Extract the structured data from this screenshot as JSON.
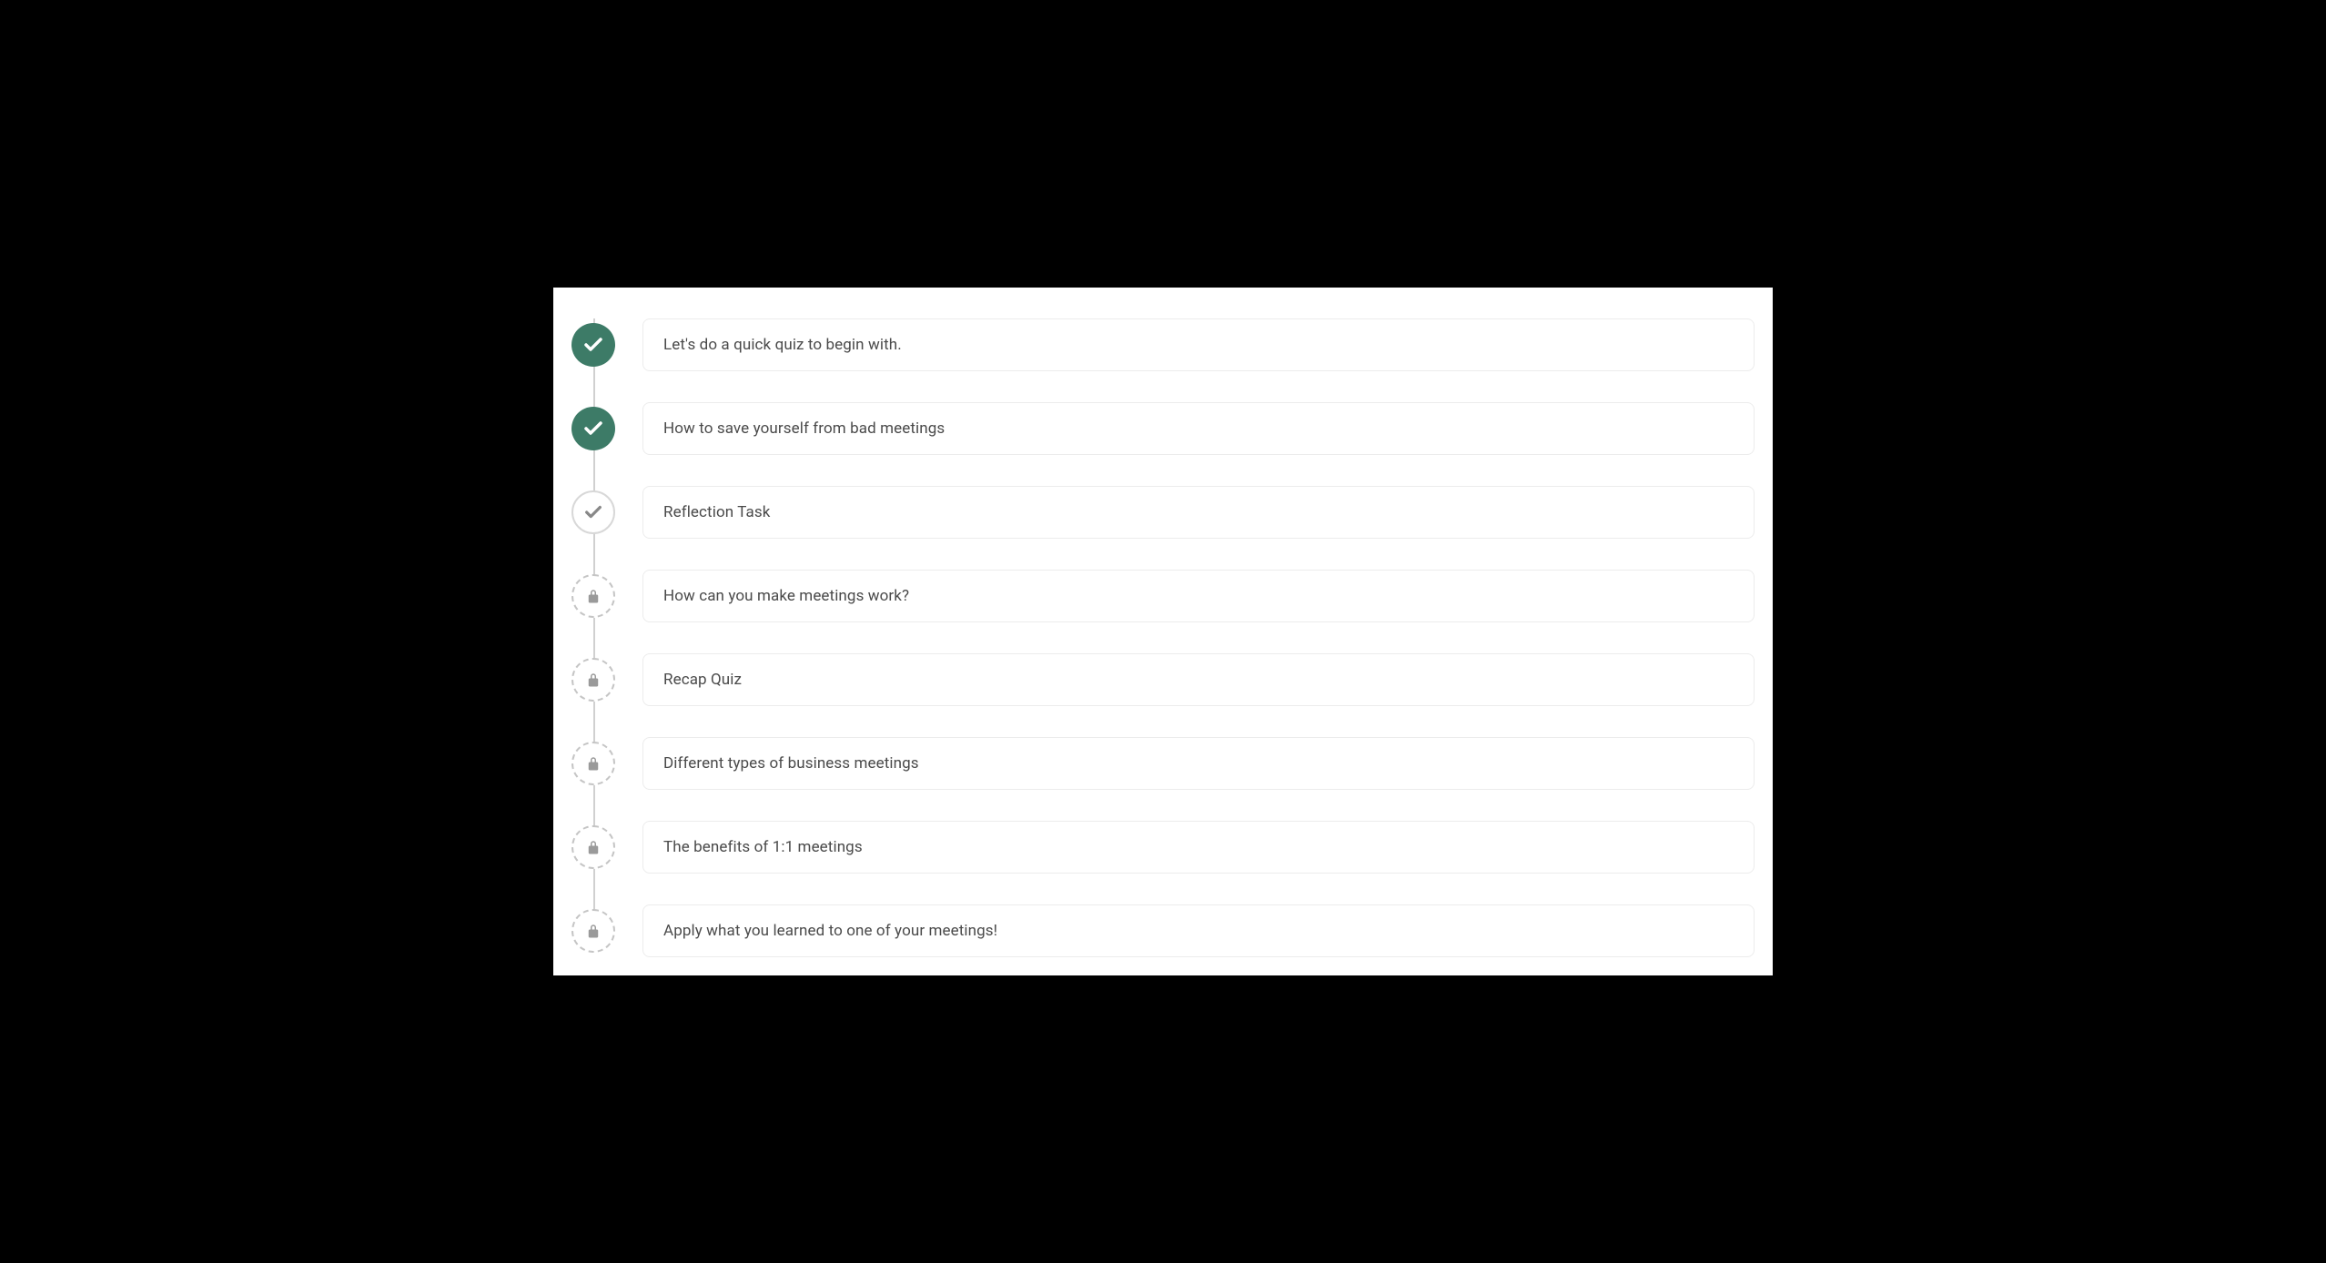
{
  "colors": {
    "completed_bg": "#3d7b67",
    "locked_icon": "#9a9a9a",
    "text": "#4a4a4a"
  },
  "lessons": [
    {
      "state": "completed",
      "title": "Let's do a quick quiz to begin with."
    },
    {
      "state": "completed",
      "title": "How to save yourself from bad meetings"
    },
    {
      "state": "current",
      "title": "Reflection Task"
    },
    {
      "state": "locked",
      "title": "How can you make meetings work?"
    },
    {
      "state": "locked",
      "title": "Recap Quiz"
    },
    {
      "state": "locked",
      "title": "Different types of business meetings"
    },
    {
      "state": "locked",
      "title": "The benefits of 1:1 meetings"
    },
    {
      "state": "locked",
      "title": "Apply what you learned to one of your meetings!"
    }
  ]
}
